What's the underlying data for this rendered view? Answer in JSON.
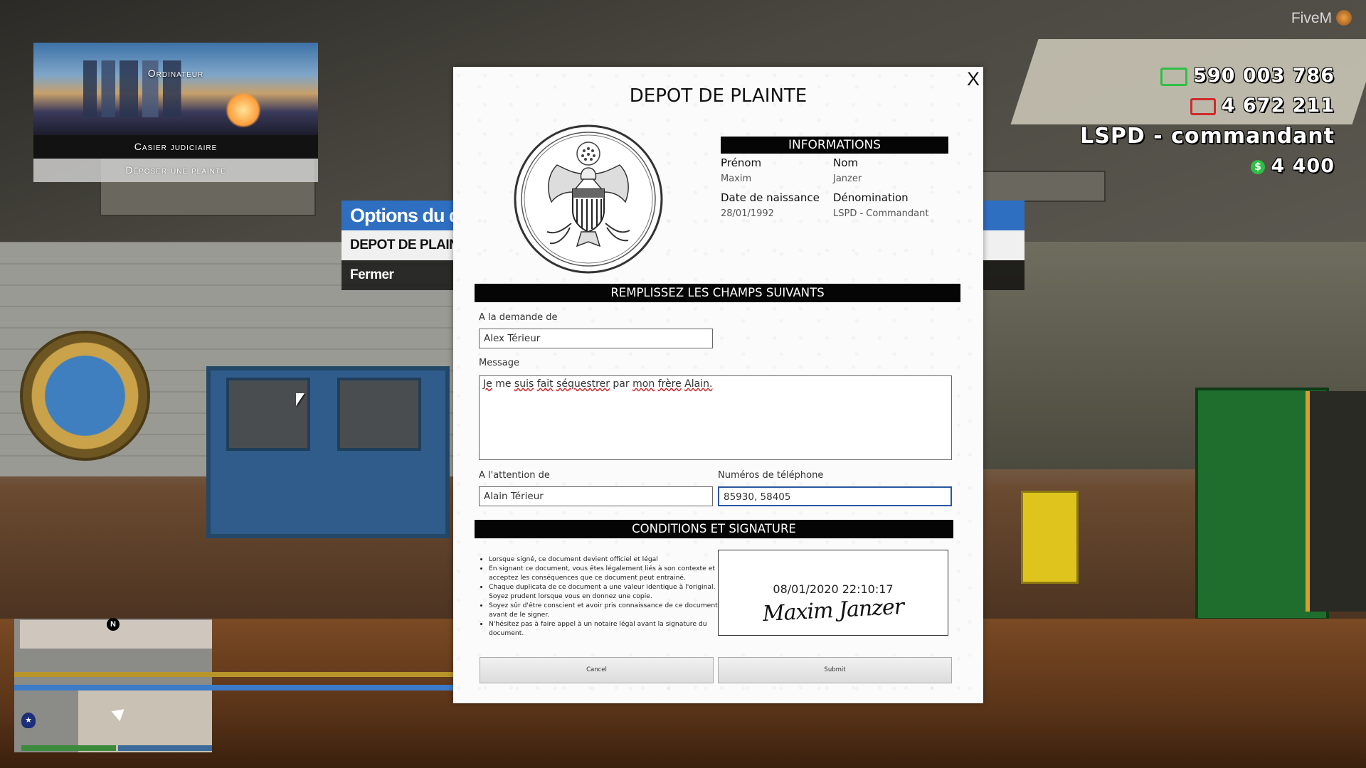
{
  "computer_menu": {
    "title": "Ordinateur",
    "items": [
      {
        "label": "Casier judiciaire",
        "active": true
      },
      {
        "label": "Déposer une plainte",
        "active": false
      }
    ]
  },
  "options_menu": {
    "header": "Options du document",
    "items": [
      {
        "label": "DEPOT DE PLAINTE",
        "selected": true
      },
      {
        "label": "Fermer",
        "selected": false
      }
    ]
  },
  "hud": {
    "brand": "FiveM",
    "bank": "590 003 786",
    "dirty": "4 672 211",
    "job": "LSPD - commandant",
    "cash": "4 400",
    "cash_symbol": "$",
    "colors": {
      "bank": "#2fbf46",
      "dirty": "#d02a2a",
      "cash": "#2fbf46"
    }
  },
  "minimap": {
    "compass": "N",
    "police_symbol": "★"
  },
  "form": {
    "close": "X",
    "title": "DEPOT DE PLAINTE",
    "informations": {
      "header": "INFORMATIONS",
      "prenom_label": "Prénom",
      "prenom_value": "Maxim",
      "nom_label": "Nom",
      "nom_value": "Janzer",
      "dob_label": "Date de naissance",
      "dob_value": "28/01/1992",
      "denom_label": "Dénomination",
      "denom_value": "LSPD - Commandant"
    },
    "fields_header": "REMPLISSEZ LES CHAMPS SUIVANTS",
    "demande_label": "A la demande de",
    "demande_value": "Alex Térieur",
    "message_label": "Message",
    "message_words": [
      "Je",
      "me",
      "suis",
      "fait",
      "séquestrer",
      "par",
      "mon",
      "frère",
      "Alain."
    ],
    "attention_label": "A l'attention de",
    "attention_value": "Alain Térieur",
    "phone_label": "Numéros de téléphone",
    "phone_value": "85930, 58405",
    "conditions_header": "CONDITIONS ET SIGNATURE",
    "conditions": [
      "Lorsque signé, ce document devient officiel et légal",
      "En signant ce document, vous êtes légalement liés à son contexte et acceptez les conséquences que ce document peut entrainé.",
      "Chaque duplicata de ce document a une valeur identique à l'original. Soyez prudent lorsque vous en donnez une copie.",
      "Soyez sûr d'être conscient et avoir pris connaissance de ce document avant de le signer.",
      "N'hésitez pas à faire appel à un notaire légal avant la signature du document."
    ],
    "signature_date": "08/01/2020 22:10:17",
    "signature_name": "Maxim Janzer",
    "cancel_label": "Cancel",
    "submit_label": "Submit"
  }
}
